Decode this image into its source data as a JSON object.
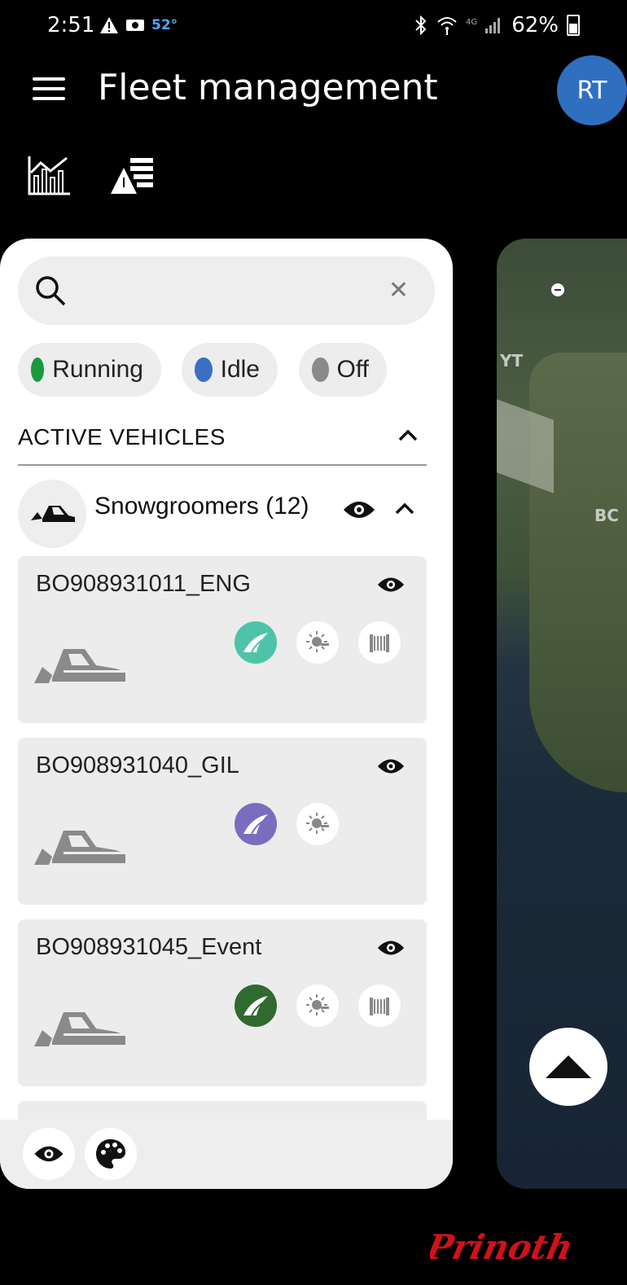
{
  "status_bar": {
    "time": "2:51",
    "temperature": "52°",
    "battery": "62%"
  },
  "header": {
    "title": "Fleet management",
    "avatar_initials": "RT"
  },
  "search": {
    "placeholder": "",
    "value": ""
  },
  "filters": [
    {
      "label": "Running",
      "color": "#1a9a3c"
    },
    {
      "label": "Idle",
      "color": "#3a6fc4"
    },
    {
      "label": "Off",
      "color": "#8a8a8a"
    }
  ],
  "section": {
    "title": "ACTIVE VEHICLES"
  },
  "group": {
    "label": "Snowgroomers (12)"
  },
  "vehicles": [
    {
      "name": "BO908931011_ENG",
      "badge_color": "#4fc3a9"
    },
    {
      "name": "BO908931040_GIL",
      "badge_color": "#7c6cc0"
    },
    {
      "name": "BO908931045_Event",
      "badge_color": "#2f6a2e"
    }
  ],
  "map": {
    "labels": [
      "YT",
      "BC"
    ]
  },
  "brand": {
    "logo_text": "Prinoth",
    "logo_color": "#d0111b"
  }
}
